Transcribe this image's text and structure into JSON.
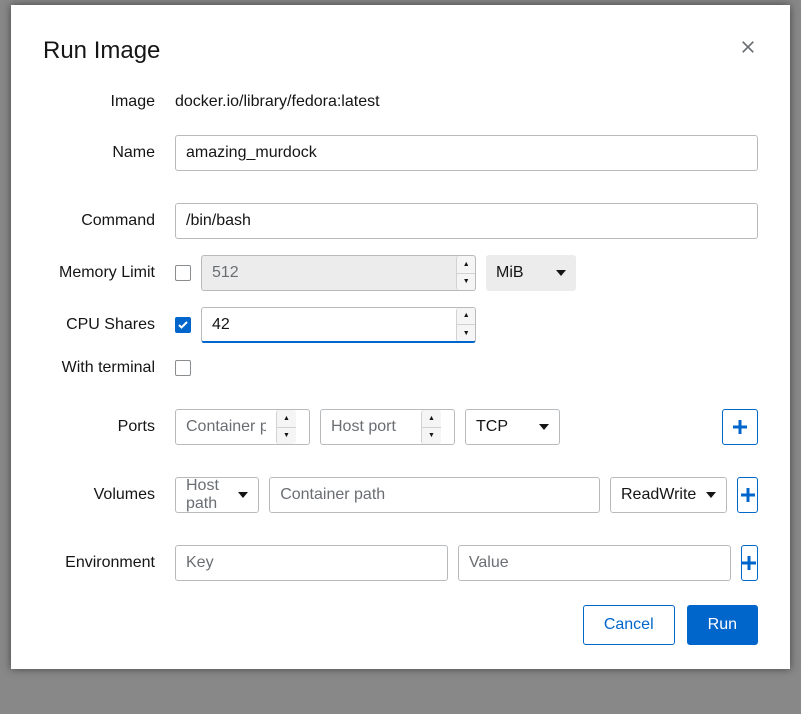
{
  "modal": {
    "title": "Run Image"
  },
  "fields": {
    "image": {
      "label": "Image",
      "value": "docker.io/library/fedora:latest"
    },
    "name": {
      "label": "Name",
      "value": "amazing_murdock"
    },
    "command": {
      "label": "Command",
      "value": "/bin/bash"
    },
    "memory": {
      "label": "Memory Limit",
      "value": "512",
      "unit": "MiB"
    },
    "cpu": {
      "label": "CPU Shares",
      "value": "42"
    },
    "terminal": {
      "label": "With terminal"
    },
    "ports": {
      "label": "Ports",
      "container_placeholder": "Container port",
      "host_placeholder": "Host port",
      "protocol": "TCP"
    },
    "volumes": {
      "label": "Volumes",
      "host_placeholder": "Host path",
      "container_placeholder": "Container path",
      "mode": "ReadWrite"
    },
    "env": {
      "label": "Environment",
      "key_placeholder": "Key",
      "value_placeholder": "Value"
    }
  },
  "footer": {
    "cancel": "Cancel",
    "run": "Run"
  }
}
